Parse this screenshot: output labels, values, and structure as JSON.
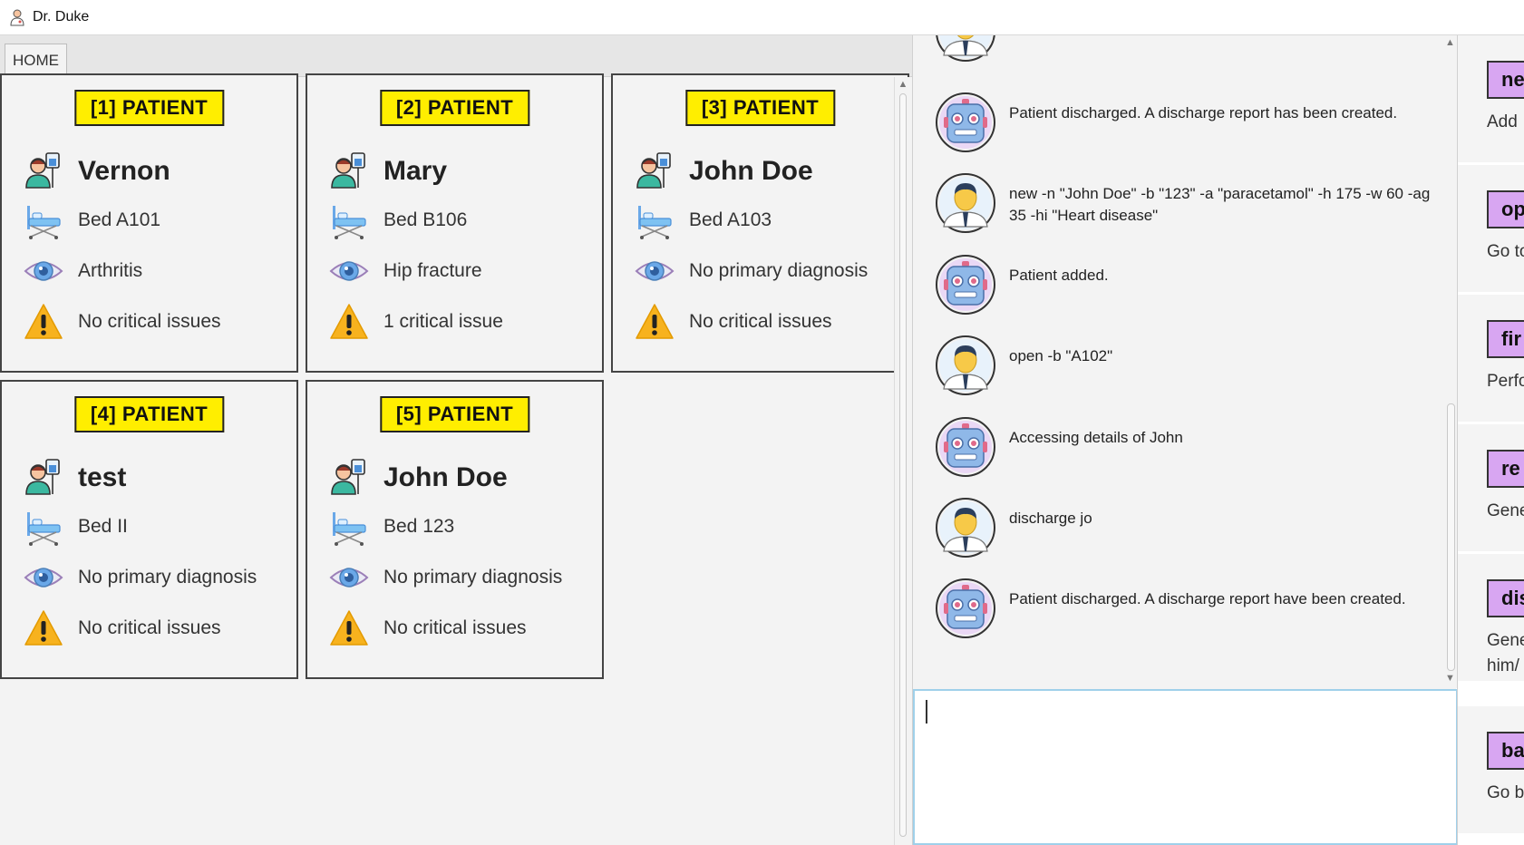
{
  "window": {
    "title": "Dr. Duke",
    "icon": "doctor-icon"
  },
  "tabs": [
    {
      "label": "HOME"
    }
  ],
  "patients": [
    {
      "badge": "[1] PATIENT",
      "name": "Vernon",
      "bed": "Bed A101",
      "diagnosis": "Arthritis",
      "critical": "No critical issues"
    },
    {
      "badge": "[2] PATIENT",
      "name": "Mary",
      "bed": "Bed B106",
      "diagnosis": "Hip fracture",
      "critical": "1 critical issue"
    },
    {
      "badge": "[3] PATIENT",
      "name": "John Doe",
      "bed": "Bed A103",
      "diagnosis": "No primary diagnosis",
      "critical": "No critical issues"
    },
    {
      "badge": "[4] PATIENT",
      "name": "test",
      "bed": "Bed II",
      "diagnosis": "No primary diagnosis",
      "critical": "No critical issues"
    },
    {
      "badge": "[5] PATIENT",
      "name": "John Doe",
      "bed": "Bed 123",
      "diagnosis": "No primary diagnosis",
      "critical": "No critical issues"
    }
  ],
  "chat": [
    {
      "sender": "user",
      "text": ""
    },
    {
      "sender": "bot",
      "text": "Patient discharged. A discharge report has been created."
    },
    {
      "sender": "user",
      "text": "new -n \"John Doe\" -b \"123\" -a \"paracetamol\" -h 175 -w 60 -ag 35 -hi \"Heart disease\""
    },
    {
      "sender": "bot",
      "text": "Patient added."
    },
    {
      "sender": "user",
      "text": "open -b \"A102\""
    },
    {
      "sender": "bot",
      "text": "Accessing details of John"
    },
    {
      "sender": "user",
      "text": "discharge jo"
    },
    {
      "sender": "bot",
      "text": "Patient discharged. A discharge report have been created."
    }
  ],
  "input": {
    "value": ""
  },
  "help": [
    {
      "command": "ne",
      "description": "Add"
    },
    {
      "command": "op",
      "description": "Go to"
    },
    {
      "command": "fir",
      "description": "Perfo"
    },
    {
      "command": "re",
      "description": "Gene"
    },
    {
      "command": "dis",
      "description": "Gene him/"
    },
    {
      "command": "ba",
      "description": "Go b"
    }
  ],
  "icons": {
    "person": "patient-icon",
    "bed": "bed-icon",
    "eye": "eye-icon",
    "warning": "warning-icon",
    "bot": "robot-avatar-icon",
    "user": "doctor-avatar-icon"
  },
  "colors": {
    "badge": "#ffee00",
    "help_command": "#d8a6f2",
    "input_focus": "#9fd0ea"
  }
}
